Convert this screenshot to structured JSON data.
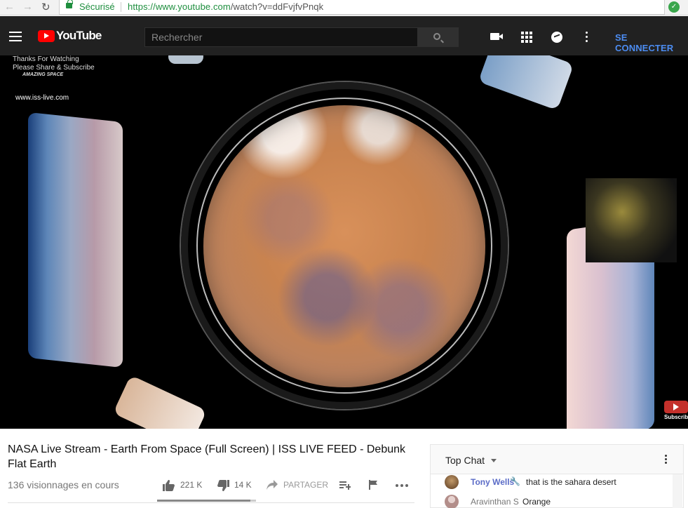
{
  "browser": {
    "secure_label": "Sécurisé",
    "url_host": "https://www.youtube.com",
    "url_path": "/watch?v=ddFvjfvPnqk"
  },
  "header": {
    "logo_text": "YouTube",
    "search_placeholder": "Rechercher",
    "signin_label": "SE CONNECTER"
  },
  "video": {
    "overlay_line1": "Thanks For Watching",
    "overlay_line2": "Please Share & Subscribe",
    "overlay_brand": "AMAZING SPACE",
    "overlay_site": "www.iss-live.com",
    "subscribe_label": "Subscribe"
  },
  "info": {
    "title": "NASA Live Stream - Earth From Space (Full Screen) | ISS LIVE FEED - Debunk Flat Earth",
    "views": "136 visionnages en cours",
    "likes": "221 K",
    "dislikes": "14 K",
    "share_label": "PARTAGER",
    "like_ratio": 0.94
  },
  "chat": {
    "header": "Top Chat",
    "messages": [
      {
        "author": "Tony Wells",
        "text": "that is the sahara desert",
        "author_color": "#5b6cc7"
      },
      {
        "author": "Aravinthan S",
        "text": "Orange",
        "author_color": "#777777"
      }
    ]
  },
  "colors": {
    "youtube_red": "#ff0000",
    "header_bg": "#212121",
    "signin_blue": "#4c8cf1",
    "secure_green": "#1e8e3e"
  }
}
